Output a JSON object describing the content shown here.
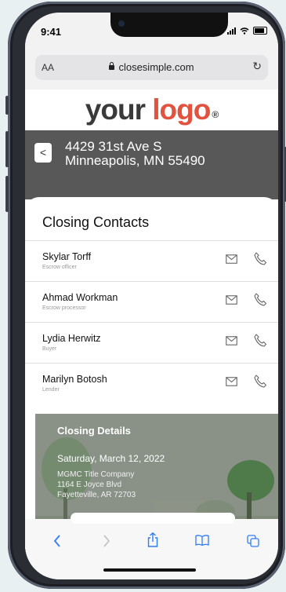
{
  "status_bar": {
    "time": "9:41"
  },
  "browser": {
    "text_size_label": "AA",
    "url": "closesimple.com",
    "reload_icon": "reload-icon"
  },
  "brand": {
    "logo_word1": "your",
    "logo_word2": "logo",
    "logo_mark": "®",
    "logo_accent_color": "#e2533f"
  },
  "property": {
    "address_line1": "4429 31st Ave S",
    "address_line2": "Minneapolis, MN 55490"
  },
  "contacts_section": {
    "title": "Closing Contacts",
    "contacts": [
      {
        "name": "Skylar Torff",
        "role": "Escrow officer"
      },
      {
        "name": "Ahmad Workman",
        "role": "Escrow processor"
      },
      {
        "name": "Lydia Herwitz",
        "role": "Buyer"
      },
      {
        "name": "Marilyn Botosh",
        "role": "Lender"
      }
    ]
  },
  "closing_details": {
    "title": "Closing Details",
    "date": "Saturday, March 12, 2022",
    "company": "MGMC Title Company",
    "street": "1164 E Joyce Blvd",
    "city": "Fayetteville, AR 72703"
  }
}
